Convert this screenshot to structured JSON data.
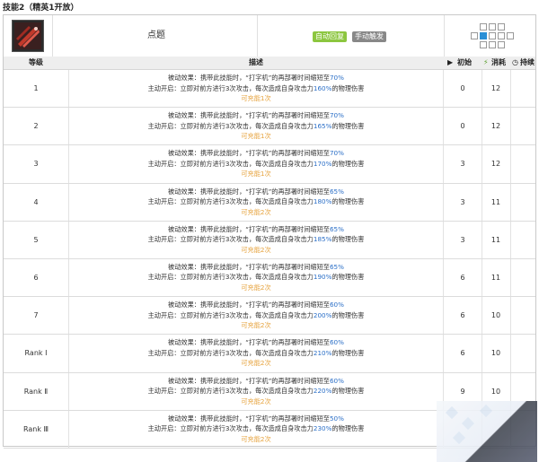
{
  "title": "技能2（精英1开放）",
  "skill": {
    "icon": "skill-icon",
    "name": "点题",
    "tags": [
      "自动回复",
      "手动触发"
    ],
    "range_icon": "range-grid-icon"
  },
  "columns": {
    "level": "等级",
    "desc": "描述",
    "sp": "初始",
    "cost": "消耗",
    "duration": "持续"
  },
  "labels": {
    "passive_a": "被动效果：携带此技能时，“打字机”的再部署时间缩短至",
    "active_a": "主动开启：立即对前方进行3次攻击，每次造成自身攻击力",
    "active_b": "的物理伤害"
  },
  "rows": [
    {
      "level": "1",
      "pct_redeploy": "70%",
      "pct_atk": "160%",
      "charges": "可充能1次",
      "sp": "0",
      "cost": "12",
      "duration": ""
    },
    {
      "level": "2",
      "pct_redeploy": "70%",
      "pct_atk": "165%",
      "charges": "可充能1次",
      "sp": "0",
      "cost": "12",
      "duration": ""
    },
    {
      "level": "3",
      "pct_redeploy": "70%",
      "pct_atk": "170%",
      "charges": "可充能1次",
      "sp": "3",
      "cost": "12",
      "duration": ""
    },
    {
      "level": "4",
      "pct_redeploy": "65%",
      "pct_atk": "180%",
      "charges": "可充能2次",
      "sp": "3",
      "cost": "11",
      "duration": ""
    },
    {
      "level": "5",
      "pct_redeploy": "65%",
      "pct_atk": "185%",
      "charges": "可充能2次",
      "sp": "3",
      "cost": "11",
      "duration": ""
    },
    {
      "level": "6",
      "pct_redeploy": "65%",
      "pct_atk": "190%",
      "charges": "可充能2次",
      "sp": "6",
      "cost": "11",
      "duration": ""
    },
    {
      "level": "7",
      "pct_redeploy": "60%",
      "pct_atk": "200%",
      "charges": "可充能2次",
      "sp": "6",
      "cost": "10",
      "duration": ""
    },
    {
      "level": "Rank Ⅰ",
      "pct_redeploy": "60%",
      "pct_atk": "210%",
      "charges": "可充能2次",
      "sp": "6",
      "cost": "10",
      "duration": ""
    },
    {
      "level": "Rank Ⅱ",
      "pct_redeploy": "60%",
      "pct_atk": "220%",
      "charges": "可充能2次",
      "sp": "9",
      "cost": "10",
      "duration": ""
    },
    {
      "level": "Rank Ⅲ",
      "pct_redeploy": "50%",
      "pct_atk": "230%",
      "charges": "可充能2次",
      "sp": "",
      "cost": "",
      "duration": ""
    }
  ]
}
